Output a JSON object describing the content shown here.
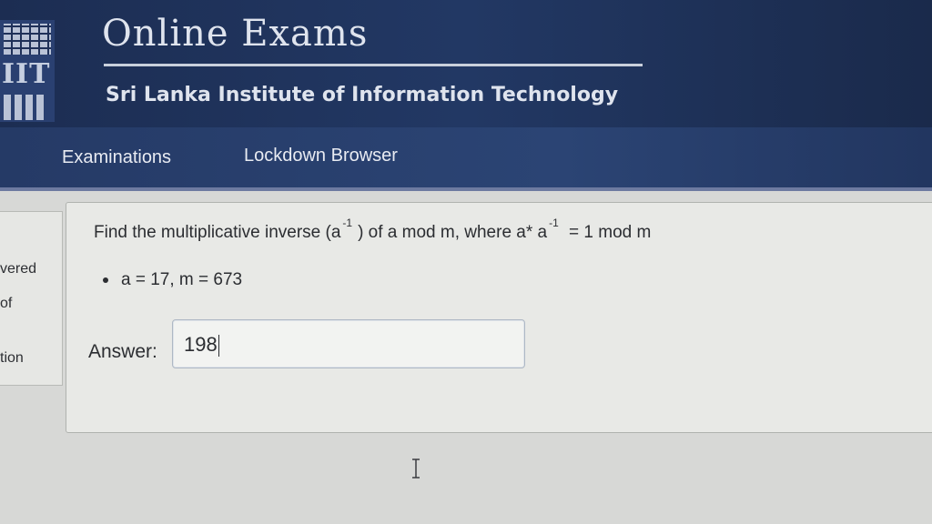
{
  "header": {
    "logo_text": "IIT",
    "site_title": "Online Exams",
    "institute": "Sri Lanka Institute of Information Technology"
  },
  "nav": {
    "items": [
      {
        "label": "Examinations"
      },
      {
        "label": "Lockdown Browser"
      }
    ]
  },
  "side_panel": {
    "lines": [
      "vered",
      "of",
      "tion"
    ]
  },
  "question": {
    "text_part1": "Find the multiplicative inverse (a",
    "sup1": "-1",
    "text_part2": ") of  a mod m, where a* a",
    "sup2": "-1",
    "text_part3": " = 1 mod m",
    "bullet": "a = 17, m = 673"
  },
  "answer": {
    "label": "Answer:",
    "value": "198"
  }
}
